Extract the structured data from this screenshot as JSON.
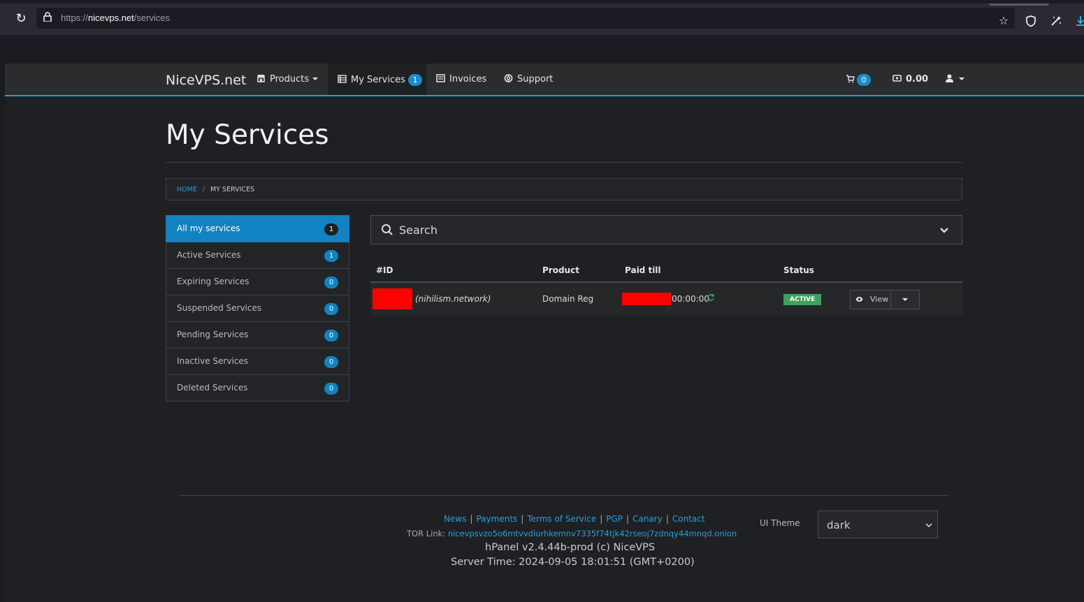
{
  "browser": {
    "url_prefix": "https://",
    "url_domain": "nicevps.net",
    "url_path": "/services"
  },
  "nav": {
    "brand": "NiceVPS.net",
    "products": "Products",
    "my_services": "My Services",
    "my_services_count": "1",
    "invoices": "Invoices",
    "support": "Support",
    "cart_count": "0",
    "balance": "0.00"
  },
  "page": {
    "title": "My Services"
  },
  "breadcrumb": {
    "home": "HOME",
    "separator": "/",
    "current": "MY SERVICES"
  },
  "sidebar": {
    "items": [
      {
        "label": "All my services",
        "count": "1"
      },
      {
        "label": "Active Services",
        "count": "1"
      },
      {
        "label": "Expiring Services",
        "count": "0"
      },
      {
        "label": "Suspended Services",
        "count": "0"
      },
      {
        "label": "Pending Services",
        "count": "0"
      },
      {
        "label": "Inactive Services",
        "count": "0"
      },
      {
        "label": "Deleted Services",
        "count": "0"
      }
    ]
  },
  "search": {
    "placeholder": "Search"
  },
  "table": {
    "headers": {
      "id": "#ID",
      "product": "Product",
      "paid_till": "Paid till",
      "status": "Status"
    },
    "rows": [
      {
        "domain": "(nihilism.network)",
        "product": "Domain Reg",
        "paid_till_time": "00:00:00",
        "status": "ACTIVE",
        "action": "View"
      }
    ]
  },
  "footer": {
    "links": [
      "News",
      "Payments",
      "Terms of Service",
      "PGP",
      "Canary",
      "Contact"
    ],
    "tor_label": "TOR Link:",
    "tor_link": "nicevpsvzo5o6mtvvdiurhkemnv7335f74tjk42rseoj7zdnqy44mnqd.onion",
    "version": "hPanel v2.4.44b-prod (c) NiceVPS",
    "server_time": "Server Time: 2024-09-05 18:01:51 (GMT+0200)",
    "theme_label": "UI Theme",
    "theme_value": "dark"
  },
  "colors": {
    "accent": "#2a9fd6",
    "active_list": "#1183c2",
    "status_active": "#3fa15b",
    "redaction": "#ff0000"
  }
}
